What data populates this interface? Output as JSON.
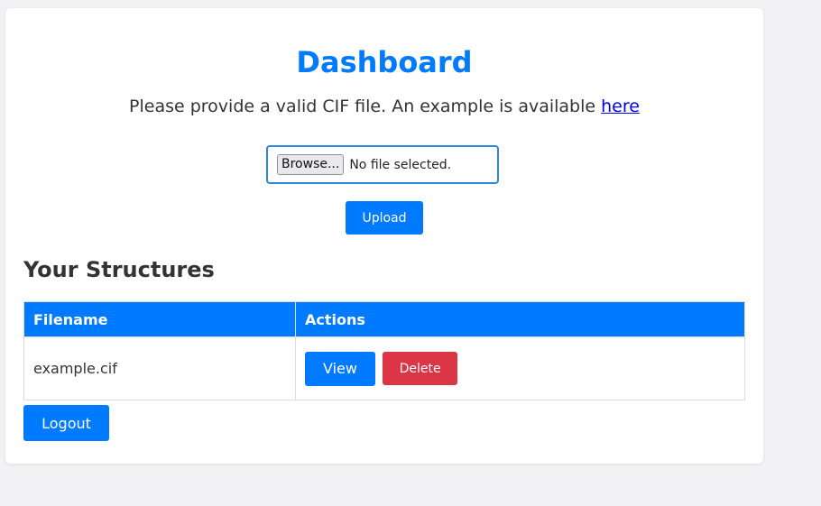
{
  "header": {
    "title": "Dashboard",
    "instruction_text": "Please provide a valid CIF file. An example is available",
    "example_link_label": "here"
  },
  "upload": {
    "browse_label": "Browse...",
    "file_status": "No file selected.",
    "upload_label": "Upload"
  },
  "structures": {
    "heading": "Your Structures",
    "columns": [
      "Filename",
      "Actions"
    ],
    "rows": [
      {
        "filename": "example.cif",
        "view_label": "View",
        "delete_label": "Delete"
      }
    ]
  },
  "footer": {
    "logout_label": "Logout"
  },
  "colors": {
    "accent": "#007bff",
    "danger": "#dc3545",
    "background": "#f2f2f5",
    "link": "#0000ee"
  }
}
